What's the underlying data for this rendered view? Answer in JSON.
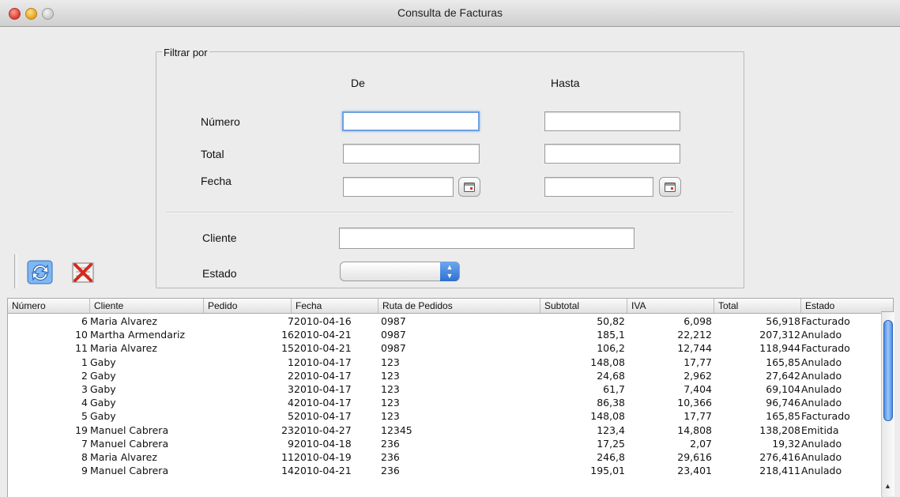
{
  "window": {
    "title": "Consulta de Facturas"
  },
  "filter": {
    "legend": "Filtrar por",
    "col_from": "De",
    "col_to": "Hasta",
    "numero_label": "Número",
    "total_label": "Total",
    "fecha_label": "Fecha",
    "cliente_label": "Cliente",
    "estado_label": "Estado",
    "numero_from": "",
    "numero_to": "",
    "total_from": "",
    "total_to": "",
    "fecha_from": "",
    "fecha_to": "",
    "cliente": "",
    "estado": ""
  },
  "toolbar": {
    "refresh_icon": "refresh-icon",
    "clear_icon": "clear-filter-icon"
  },
  "table": {
    "columns": [
      "Número",
      "Cliente",
      "Pedido",
      "Fecha",
      "Ruta de Pedidos",
      "Subtotal",
      "IVA",
      "Total",
      "Estado"
    ],
    "rows": [
      [
        "6",
        "Maria Alvarez",
        "7",
        "2010-04-16",
        "0987",
        "50,82",
        "6,098",
        "56,918",
        "Facturado"
      ],
      [
        "10",
        "Martha Armendariz",
        "16",
        "2010-04-21",
        "0987",
        "185,1",
        "22,212",
        "207,312",
        "Anulado"
      ],
      [
        "11",
        "Maria Alvarez",
        "15",
        "2010-04-21",
        "0987",
        "106,2",
        "12,744",
        "118,944",
        "Facturado"
      ],
      [
        "1",
        "Gaby",
        "1",
        "2010-04-17",
        "123",
        "148,08",
        "17,77",
        "165,85",
        "Anulado"
      ],
      [
        "2",
        "Gaby",
        "2",
        "2010-04-17",
        "123",
        "24,68",
        "2,962",
        "27,642",
        "Anulado"
      ],
      [
        "3",
        "Gaby",
        "3",
        "2010-04-17",
        "123",
        "61,7",
        "7,404",
        "69,104",
        "Anulado"
      ],
      [
        "4",
        "Gaby",
        "4",
        "2010-04-17",
        "123",
        "86,38",
        "10,366",
        "96,746",
        "Anulado"
      ],
      [
        "5",
        "Gaby",
        "5",
        "2010-04-17",
        "123",
        "148,08",
        "17,77",
        "165,85",
        "Facturado"
      ],
      [
        "19",
        "Manuel Cabrera",
        "23",
        "2010-04-27",
        "12345",
        "123,4",
        "14,808",
        "138,208",
        "Emitida"
      ],
      [
        "7",
        "Manuel Cabrera",
        "9",
        "2010-04-18",
        "236",
        "17,25",
        "2,07",
        "19,32",
        "Anulado"
      ],
      [
        "8",
        "Maria Alvarez",
        "11",
        "2010-04-19",
        "236",
        "246,8",
        "29,616",
        "276,416",
        "Anulado"
      ],
      [
        "9",
        "Manuel Cabrera",
        "14",
        "2010-04-21",
        "236",
        "195,01",
        "23,401",
        "218,411",
        "Anulado"
      ]
    ]
  }
}
